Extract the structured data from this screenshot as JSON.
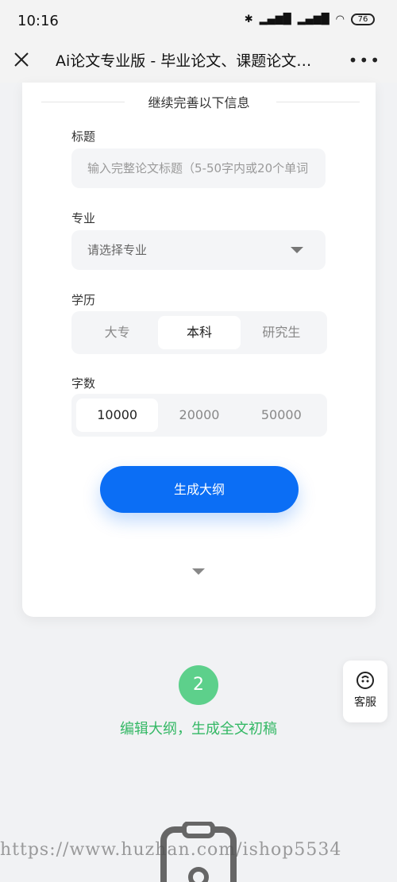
{
  "status_bar": {
    "time": "10:16",
    "bt_icon": "bluetooth-icon",
    "signal_icon": "signal-icon",
    "wifi_icon": "wifi-icon",
    "battery": "76"
  },
  "nav": {
    "title": "Ai论文专业版 - 毕业论文、课题论文…",
    "more": "•••"
  },
  "form": {
    "section_title": "继续完善以下信息",
    "title_label": "标题",
    "title_placeholder": "输入完整论文标题（5-50字内或20个单词",
    "major_label": "专业",
    "major_placeholder": "请选择专业",
    "degree_label": "学历",
    "degree_options": [
      "大专",
      "本科",
      "研究生"
    ],
    "degree_selected": "本科",
    "words_label": "字数",
    "words_options": [
      "10000",
      "20000",
      "50000"
    ],
    "words_selected": "10000",
    "generate_button": "生成大纲"
  },
  "step2": {
    "number": "2",
    "text": "编辑大纲，生成全文初稿"
  },
  "service": {
    "label": "客服",
    "icon": "headset-icon"
  },
  "watermark": "https://www.huzhan.com/ishop5534",
  "colors": {
    "accent": "#0b6ef5",
    "step_green": "#5dd08b",
    "step_text_green": "#34b865"
  }
}
